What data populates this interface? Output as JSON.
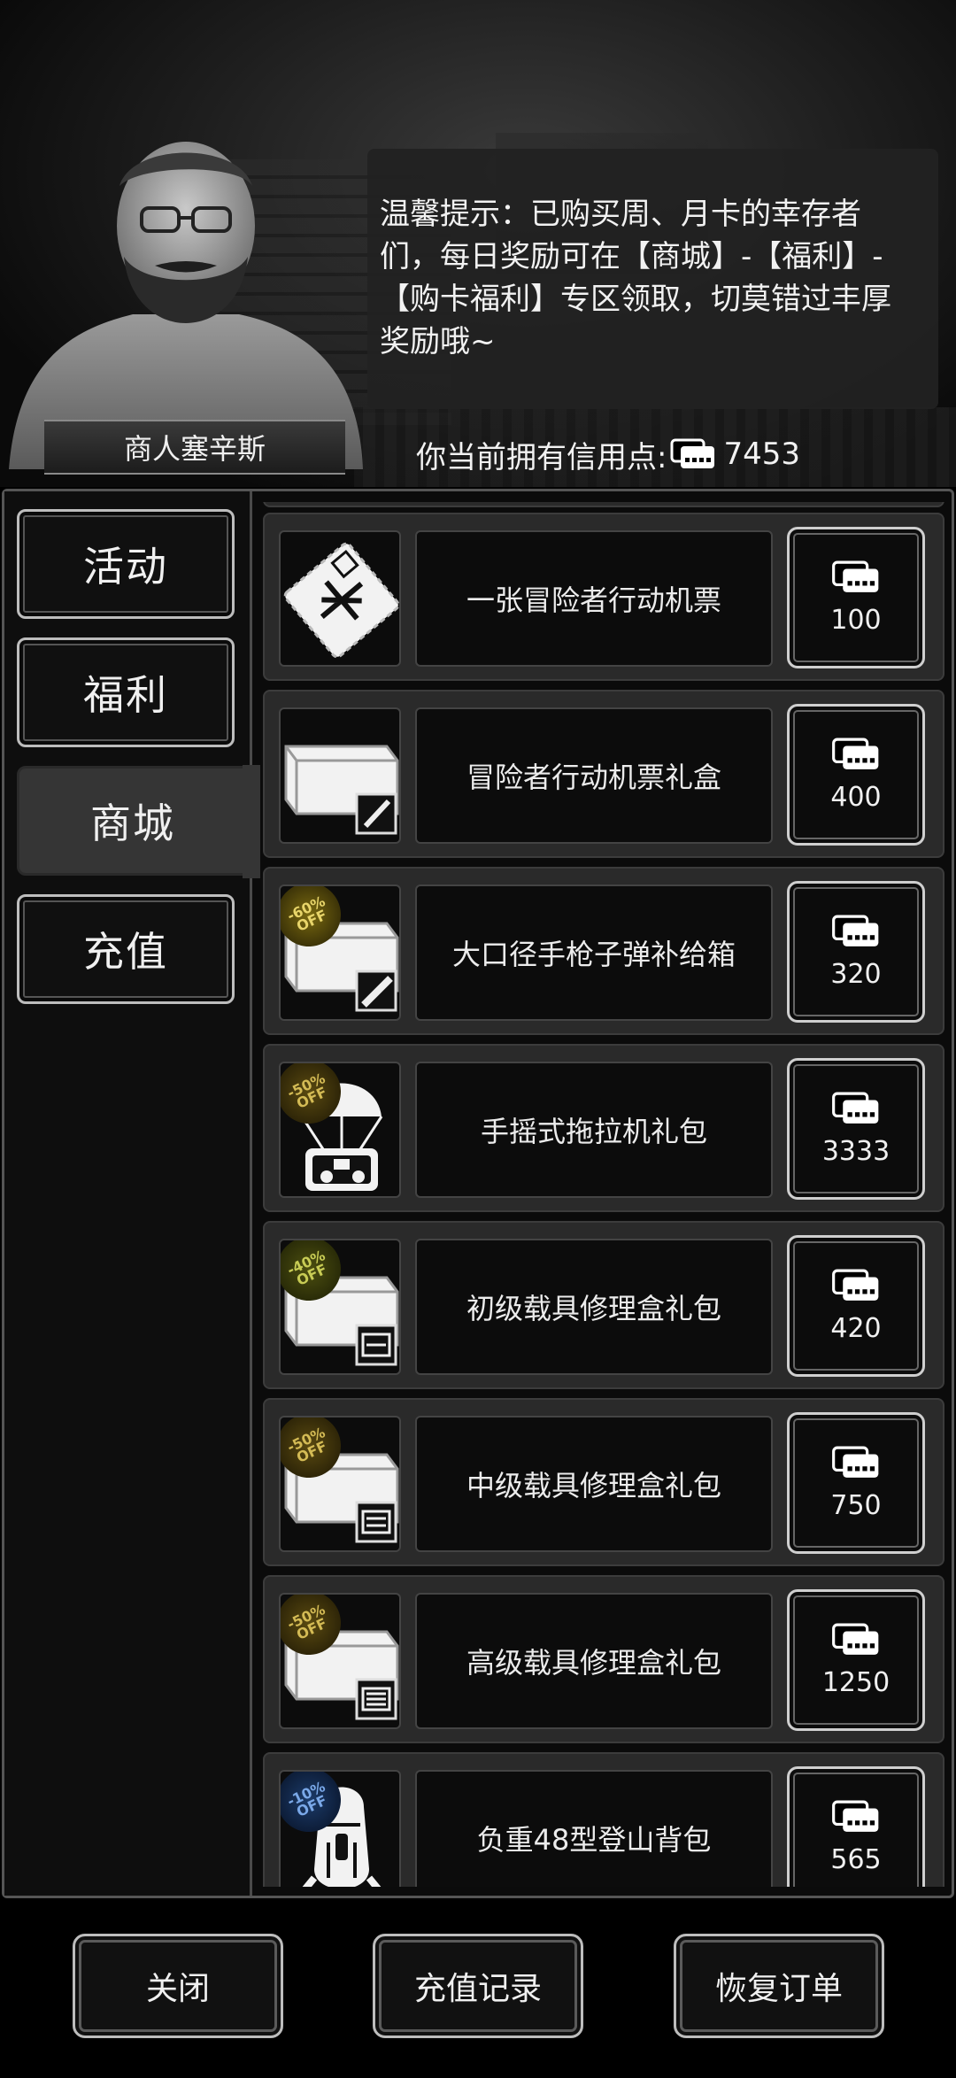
{
  "merchant": {
    "name": "商人塞辛斯",
    "tip": "温馨提示：已购买周、月卡的幸存者们，每日奖励可在【商城】-【福利】-【购卡福利】专区领取，切莫错过丰厚奖励哦~"
  },
  "credits": {
    "label": "你当前拥有信用点:",
    "value": "7453",
    "icon": "credit-card-icon"
  },
  "tabs": [
    {
      "label": "活动",
      "active": false
    },
    {
      "label": "福利",
      "active": false
    },
    {
      "label": "商城",
      "active": true
    },
    {
      "label": "充值",
      "active": false
    }
  ],
  "items": [
    {
      "name": "一张冒险者行动机票",
      "price": "100",
      "icon": "ticket-icon",
      "badge": ""
    },
    {
      "name": "冒险者行动机票礼盒",
      "price": "400",
      "icon": "crate-ticket-icon",
      "badge": ""
    },
    {
      "name": "大口径手枪子弹补给箱",
      "price": "320",
      "icon": "crate-ammo-icon",
      "badge": "-60%\nOFF"
    },
    {
      "name": "手摇式拖拉机礼包",
      "price": "3333",
      "icon": "parachute-tractor-icon",
      "badge": "-50%\nOFF"
    },
    {
      "name": "初级载具修理盒礼包",
      "price": "420",
      "icon": "crate-repair-icon",
      "badge": "-40%\nOFF"
    },
    {
      "name": "中级载具修理盒礼包",
      "price": "750",
      "icon": "crate-repair-icon",
      "badge": "-50%\nOFF"
    },
    {
      "name": "高级载具修理盒礼包",
      "price": "1250",
      "icon": "crate-repair-icon",
      "badge": "-50%\nOFF"
    },
    {
      "name": "负重48型登山背包",
      "price": "565",
      "icon": "backpack-icon",
      "badge": "-10%\nOFF"
    }
  ],
  "footer": {
    "close": "关闭",
    "recharge_history": "充值记录",
    "restore_orders": "恢复订单"
  }
}
